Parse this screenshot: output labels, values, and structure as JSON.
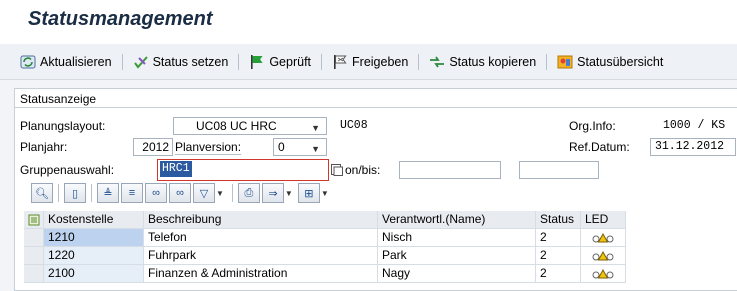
{
  "window": {
    "title": "Statusmanagement"
  },
  "toolbar": {
    "buttons": [
      {
        "label": "Aktualisieren",
        "icon": "refresh-icon"
      },
      {
        "label": "Status setzen",
        "icon": "set-status-icon"
      },
      {
        "label": "Geprüft",
        "icon": "green-flag-icon"
      },
      {
        "label": "Freigeben",
        "icon": "release-flag-icon"
      },
      {
        "label": "Status kopieren",
        "icon": "copy-status-icon"
      },
      {
        "label": "Statusübersicht",
        "icon": "status-overview-icon"
      }
    ]
  },
  "group": {
    "label": "Statusanzeige"
  },
  "form": {
    "planungslayout_label": "Planungslayout:",
    "planungslayout_value": "UC08 UC HRC",
    "planungslayout_code": "UC08",
    "planjahr_label": "Planjahr:",
    "planjahr_value": "2012",
    "planversion_label": "Planversion:",
    "planversion_value": "0",
    "gruppen_label": "Gruppenauswahl:",
    "gruppen_value": "HRC1",
    "von_bis_label": "on/bis:",
    "orginfo_label": "Org.Info:",
    "orginfo_value": "1000 / KS",
    "refdatum_label": "Ref.Datum:",
    "refdatum_value": "31.12.2012"
  },
  "table": {
    "columns": [
      "Kostenstelle",
      "Beschreibung",
      "Verantwortl.(Name)",
      "Status",
      "LED"
    ],
    "rows": [
      {
        "kostenstelle": "1210",
        "beschreibung": "Telefon",
        "verantwortlich": "Nisch",
        "status": "2"
      },
      {
        "kostenstelle": "1220",
        "beschreibung": "Fuhrpark",
        "verantwortlich": "Park",
        "status": "2"
      },
      {
        "kostenstelle": "2100",
        "beschreibung": "Finanzen & Administration",
        "verantwortlich": "Nagy",
        "status": "2"
      }
    ]
  },
  "colors": {
    "title": "#1b2d45",
    "selection": "#2c5aa0",
    "led_yellow": "#f1c40f"
  }
}
